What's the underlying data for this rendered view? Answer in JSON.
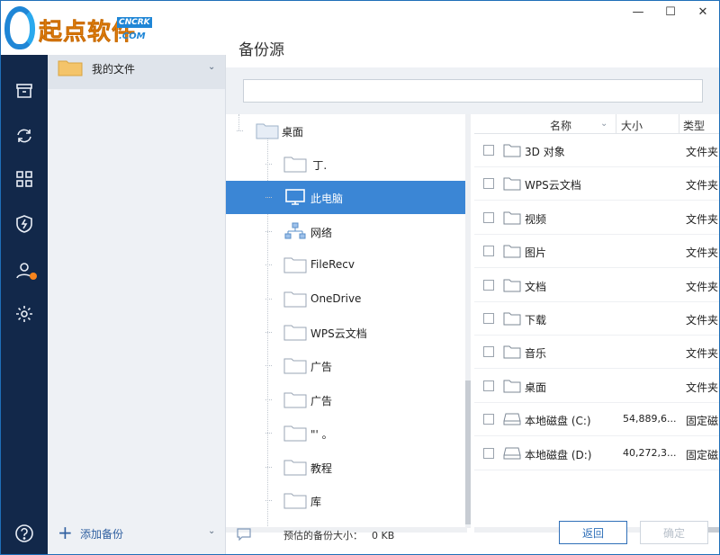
{
  "window": {
    "controls": {
      "minimize": "—",
      "maximize": "☐",
      "close": "✕"
    }
  },
  "logo": {
    "brand": "起点软件",
    "tag_top": "CNCRK",
    "tag_bottom": ".COM"
  },
  "rail": {
    "icons": [
      "archive-icon",
      "sync-icon",
      "apps-grid-icon",
      "shield-bolt-icon",
      "account-icon",
      "settings-gear-icon",
      "help-icon"
    ],
    "badge_color": "#f7841d"
  },
  "side": {
    "selected_item": "我的文件",
    "add_backup": "添加备份"
  },
  "main": {
    "title": "备份源",
    "search": {
      "value": "",
      "placeholder": ""
    }
  },
  "tree": {
    "root": "桌面",
    "items": [
      {
        "label": "  丁.",
        "icon": "folder-icon"
      },
      {
        "label": "此电脑",
        "icon": "monitor-icon",
        "selected": true
      },
      {
        "label": "网络",
        "icon": "network-icon"
      },
      {
        "label": "FileRecv",
        "icon": "folder-icon"
      },
      {
        "label": "OneDrive",
        "icon": "folder-icon"
      },
      {
        "label": "WPS云文档",
        "icon": "folder-icon"
      },
      {
        "label": "广告",
        "icon": "folder-icon"
      },
      {
        "label": "广告",
        "icon": "folder-icon"
      },
      {
        "label": "\"' 。",
        "icon": "folder-icon"
      },
      {
        "label": "教程",
        "icon": "folder-icon"
      },
      {
        "label": "库",
        "icon": "folder-icon"
      }
    ]
  },
  "list": {
    "columns": {
      "name": "名称",
      "size": "大小",
      "type": "类型"
    },
    "rows": [
      {
        "name": "3D 对象",
        "size": "",
        "type": "文件夹",
        "icon": "folder-icon"
      },
      {
        "name": "WPS云文档",
        "size": "",
        "type": "文件夹",
        "icon": "folder-icon"
      },
      {
        "name": "视频",
        "size": "",
        "type": "文件夹",
        "icon": "folder-icon"
      },
      {
        "name": "图片",
        "size": "",
        "type": "文件夹",
        "icon": "folder-icon"
      },
      {
        "name": "文档",
        "size": "",
        "type": "文件夹",
        "icon": "folder-icon"
      },
      {
        "name": "下载",
        "size": "",
        "type": "文件夹",
        "icon": "folder-icon"
      },
      {
        "name": "音乐",
        "size": "",
        "type": "文件夹",
        "icon": "folder-icon"
      },
      {
        "name": "桌面",
        "size": "",
        "type": "文件夹",
        "icon": "folder-icon"
      },
      {
        "name": "本地磁盘 (C:)",
        "size": "54,889,6...",
        "type": "固定磁",
        "icon": "drive-icon"
      },
      {
        "name": "本地磁盘 (D:)",
        "size": "40,272,3...",
        "type": "固定磁",
        "icon": "drive-icon"
      }
    ]
  },
  "footer": {
    "estimate_label": "预估的备份大小：",
    "estimate_value": "0 KB",
    "back": "返回",
    "ok": "确定"
  },
  "colors": {
    "accent": "#2f6fb8",
    "selection": "#3b86d5",
    "rail": "#12284a"
  }
}
